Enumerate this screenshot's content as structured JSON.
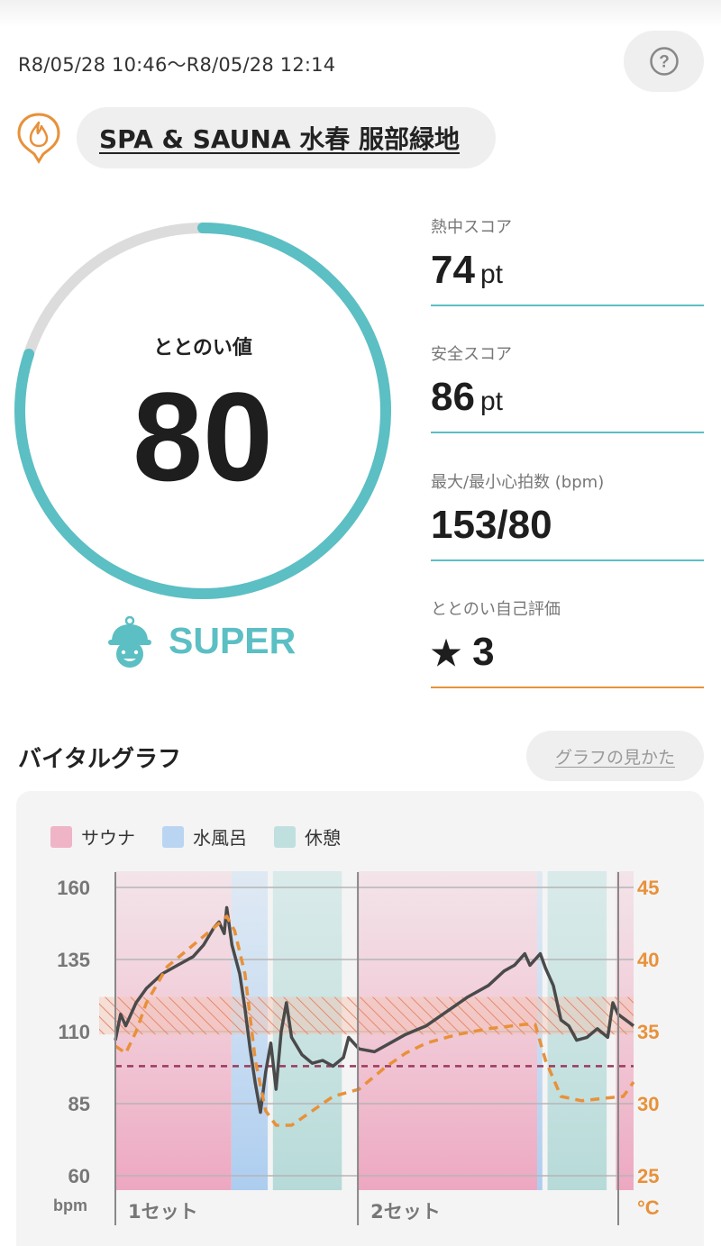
{
  "session": {
    "datetime": "R8/05/28 10:46～R8/05/28 12:14"
  },
  "help": {
    "icon": "question-icon",
    "label": "?"
  },
  "facility": {
    "icon": "sauna-flame-pin-icon",
    "name": "SPA & SAUNA 水春 服部緑地"
  },
  "totonoi": {
    "label": "ととのい値",
    "value": "80",
    "progress": 0.8,
    "rank": "SUPER",
    "rank_icon": "hat-face-icon"
  },
  "stats": [
    {
      "label": "熱中スコア",
      "value": "74",
      "unit": "pt"
    },
    {
      "label": "安全スコア",
      "value": "86",
      "unit": "pt"
    },
    {
      "label": "最大/最小心拍数 (bpm)",
      "value": "153/80",
      "unit": ""
    },
    {
      "label": "ととのい自己評価",
      "star": "★",
      "value": "3",
      "unit": ""
    }
  ],
  "graph": {
    "title": "バイタルグラフ",
    "howto_label": "グラフの見かた",
    "legend": [
      {
        "label": "サウナ",
        "color": "#f0b4c7"
      },
      {
        "label": "水風呂",
        "color": "#b9d5f2"
      },
      {
        "label": "休憩",
        "color": "#bfe0df"
      }
    ]
  },
  "chart_data": {
    "type": "line",
    "left_axis": {
      "unit": "bpm",
      "ticks": [
        "160",
        "135",
        "110",
        "85",
        "60"
      ],
      "ylim": [
        60,
        160
      ]
    },
    "right_axis": {
      "unit": "°C",
      "ticks": [
        "45",
        "40",
        "35",
        "30",
        "25"
      ],
      "ylim": [
        25,
        45
      ]
    },
    "set_labels": [
      "1セット",
      "2セット"
    ],
    "phases": [
      {
        "type": "sauna",
        "start": 0,
        "end": 0.224
      },
      {
        "type": "water",
        "start": 0.224,
        "end": 0.294
      },
      {
        "type": "rest",
        "start": 0.304,
        "end": 0.437
      },
      {
        "type": "sauna",
        "start": 0.468,
        "end": 0.814
      },
      {
        "type": "water",
        "start": 0.814,
        "end": 0.824
      },
      {
        "type": "rest",
        "start": 0.834,
        "end": 0.948
      },
      {
        "type": "sauna",
        "start": 0.966,
        "end": 1.0
      }
    ],
    "heart_rate_zone": [
      109,
      122
    ],
    "reference_line_bpm": 98,
    "series": [
      {
        "axis": "left",
        "points": [
          [
            0,
            107
          ],
          [
            0.01,
            116
          ],
          [
            0.02,
            112
          ],
          [
            0.04,
            120
          ],
          [
            0.06,
            125
          ],
          [
            0.09,
            130
          ],
          [
            0.12,
            133
          ],
          [
            0.15,
            136
          ],
          [
            0.17,
            140
          ],
          [
            0.19,
            146
          ],
          [
            0.2,
            148
          ],
          [
            0.21,
            144
          ],
          [
            0.215,
            153
          ],
          [
            0.225,
            140
          ],
          [
            0.24,
            130
          ],
          [
            0.25,
            118
          ],
          [
            0.26,
            104
          ],
          [
            0.27,
            92
          ],
          [
            0.28,
            82
          ],
          [
            0.29,
            96
          ],
          [
            0.3,
            106
          ],
          [
            0.31,
            90
          ],
          [
            0.32,
            110
          ],
          [
            0.33,
            120
          ],
          [
            0.34,
            108
          ],
          [
            0.36,
            102
          ],
          [
            0.38,
            99
          ],
          [
            0.4,
            100
          ],
          [
            0.42,
            98
          ],
          [
            0.44,
            101
          ],
          [
            0.45,
            108
          ],
          [
            0.47,
            104
          ],
          [
            0.5,
            103
          ],
          [
            0.53,
            106
          ],
          [
            0.56,
            109
          ],
          [
            0.6,
            112
          ],
          [
            0.64,
            117
          ],
          [
            0.68,
            122
          ],
          [
            0.72,
            126
          ],
          [
            0.75,
            131
          ],
          [
            0.77,
            133
          ],
          [
            0.79,
            137
          ],
          [
            0.8,
            133
          ],
          [
            0.82,
            137
          ],
          [
            0.83,
            132
          ],
          [
            0.845,
            126
          ],
          [
            0.86,
            114
          ],
          [
            0.875,
            112
          ],
          [
            0.89,
            107
          ],
          [
            0.91,
            108
          ],
          [
            0.93,
            111
          ],
          [
            0.95,
            108
          ],
          [
            0.96,
            120
          ],
          [
            0.97,
            116
          ],
          [
            0.985,
            114
          ],
          [
            1.0,
            112
          ]
        ]
      },
      {
        "axis": "right",
        "dashed": true,
        "points": [
          [
            0,
            34
          ],
          [
            0.02,
            33.5
          ],
          [
            0.04,
            35
          ],
          [
            0.06,
            37
          ],
          [
            0.1,
            39.5
          ],
          [
            0.15,
            41
          ],
          [
            0.2,
            42.5
          ],
          [
            0.215,
            43
          ],
          [
            0.23,
            42
          ],
          [
            0.25,
            39
          ],
          [
            0.27,
            33
          ],
          [
            0.29,
            29.5
          ],
          [
            0.31,
            28.5
          ],
          [
            0.34,
            28.5
          ],
          [
            0.38,
            29.5
          ],
          [
            0.42,
            30.5
          ],
          [
            0.47,
            31
          ],
          [
            0.52,
            32.5
          ],
          [
            0.56,
            33.5
          ],
          [
            0.6,
            34.2
          ],
          [
            0.66,
            34.8
          ],
          [
            0.72,
            35.2
          ],
          [
            0.79,
            35.5
          ],
          [
            0.81,
            35.5
          ],
          [
            0.83,
            33
          ],
          [
            0.86,
            30.5
          ],
          [
            0.9,
            30.2
          ],
          [
            0.95,
            30.4
          ],
          [
            0.98,
            30.5
          ],
          [
            1.0,
            31.5
          ]
        ]
      }
    ],
    "colors": {
      "sauna": "#f0b4c7",
      "water": "#b9d5f2",
      "rest": "#bfe0df",
      "heart_rate": "#4a4a4a",
      "temperature": "#e8913a",
      "reference": "#9a3a5e"
    }
  }
}
